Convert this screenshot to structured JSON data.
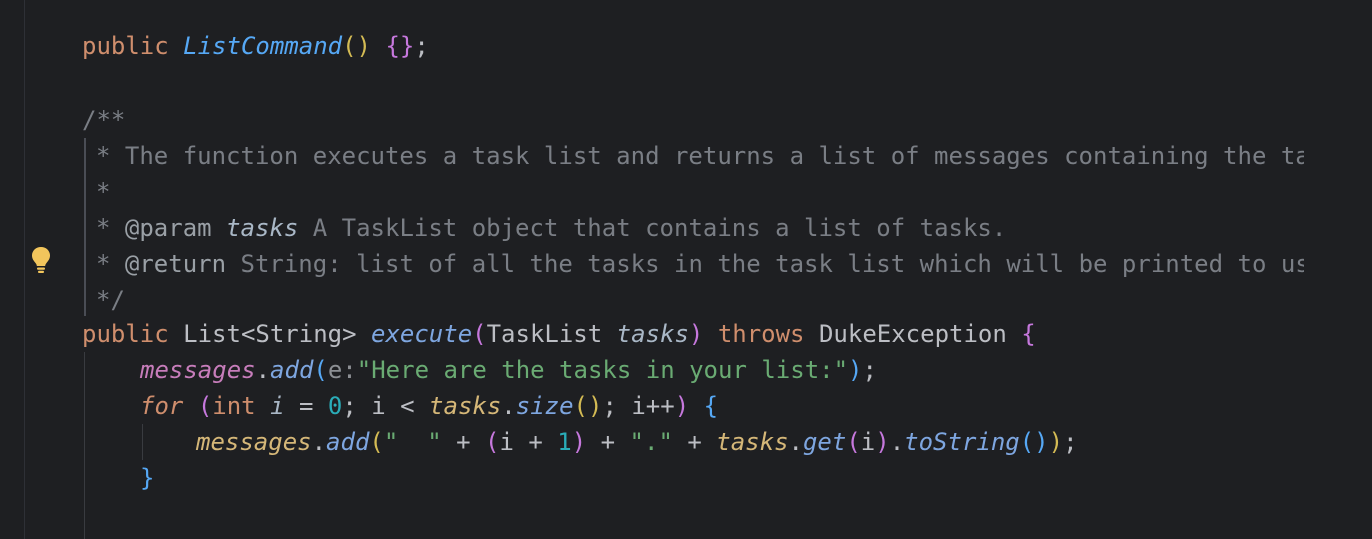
{
  "colors": {
    "background": "#1e1f22",
    "keyword": "#cf8e6d",
    "string": "#6aab73",
    "number": "#2aacb8",
    "comment": "#7a7e85",
    "method": "#56a8f5",
    "field": "#c77dbb",
    "bulb": "#f2c55c"
  },
  "code": {
    "l1": {
      "kw_public": "public",
      "ctor": "ListCommand",
      "parens": "()",
      "body": "{}",
      "semi": ";"
    },
    "doc": {
      "open": "/**",
      "line1": "* The function executes a task list and returns a list of messages containing the tasks.",
      "line2": "*",
      "line3_star": "* ",
      "line3_tag": "@param",
      "line3_param": "tasks",
      "line3_text": " A TaskList object that contains a list of tasks.",
      "line4_star": "* ",
      "line4_tag": "@return",
      "line4_text": " String: list of all the tasks in the task list which will be printed to user.",
      "close": "*/"
    },
    "sig": {
      "kw_public": "public",
      "type": "List<String>",
      "method": "execute",
      "lparen": "(",
      "ptype": "TaskList",
      "pname": "tasks",
      "rparen": ")",
      "kw_throws": "throws",
      "exc": "DukeException",
      "lbrace": "{"
    },
    "add1": {
      "field": "messages",
      "dot": ".",
      "method": "add",
      "lparen": "(",
      "hint": "e:",
      "str": "\"Here are the tasks in your list:\"",
      "rparen": ")",
      "semi": ";"
    },
    "for": {
      "kw_for": "for",
      "lparen": "(",
      "kw_int": "int",
      "var": "i",
      "assign": " = ",
      "zero": "0",
      "cond": "; i < ",
      "tasks": "tasks",
      "dot": ".",
      "size": "size",
      "call": "()",
      "incr": "; i++",
      "rparen": ")",
      "lbrace": "{"
    },
    "add2": {
      "field": "messages",
      "dot": ".",
      "method": "add",
      "lparen": "(",
      "s1": "\"  \"",
      "plus1": " + ",
      "lp": "(",
      "i": "i",
      "plus2": " + ",
      "one": "1",
      "rp": ")",
      "plus3": " + ",
      "s2": "\".\"",
      "plus4": " + ",
      "tasks": "tasks",
      "dot2": ".",
      "get": "get",
      "glp": "(",
      "gi": "i",
      "grp": ")",
      "dot3": ".",
      "tostr": "toString",
      "call": "()",
      "rparen": ")",
      "semi": ";"
    },
    "close_for": "}"
  }
}
